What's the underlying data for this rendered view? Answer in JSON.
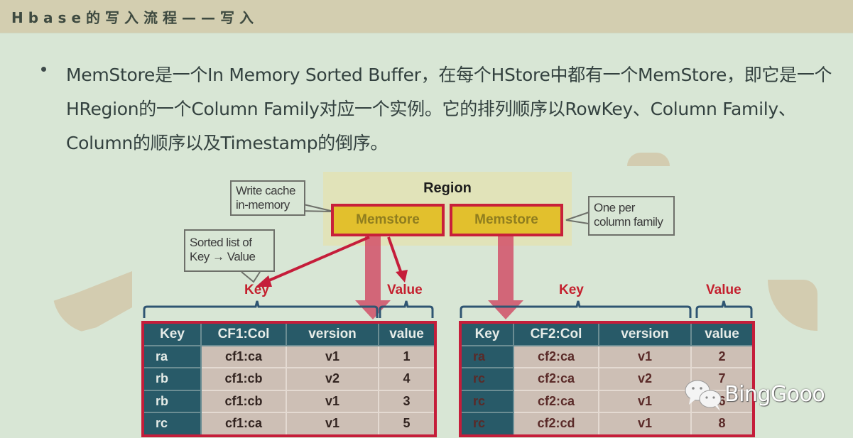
{
  "title": "Hbase的写入流程——写入",
  "bullet": {
    "text": "MemStore是一个In Memory Sorted Buffer，在每个HStore中都有一个MemStore，即它是一个HRegion的一个Column Family对应一个实例。它的排列顺序以RowKey、Column Family、Column的顺序以及Timestamp的倒序。"
  },
  "diagram": {
    "region_label": "Region",
    "memstores": [
      "Memstore",
      "Memstore"
    ],
    "callouts": {
      "write_cache": "Write cache\nin-memory",
      "sorted_list": "Sorted list of\nKey → Value",
      "one_per_cf": "One per\ncolumn family"
    },
    "left_labels": {
      "key": "Key",
      "value": "Value"
    },
    "right_labels": {
      "key": "Key",
      "value": "Value"
    },
    "colors": {
      "accent_red": "#c51d3a",
      "memstore_fill": "#e2c02d",
      "table_header": "#285a68",
      "table_cell": "#cdbfb5",
      "region_fill": "#e1e3b9"
    },
    "table1": {
      "headers": [
        "Key",
        "CF1:Col",
        "version",
        "value"
      ],
      "rows": [
        [
          "ra",
          "cf1:ca",
          "v1",
          "1"
        ],
        [
          "rb",
          "cf1:cb",
          "v2",
          "4"
        ],
        [
          "rb",
          "cf1:cb",
          "v1",
          "3"
        ],
        [
          "rc",
          "cf1:ca",
          "v1",
          "5"
        ]
      ]
    },
    "table2": {
      "headers": [
        "Key",
        "CF2:Col",
        "version",
        "value"
      ],
      "rows": [
        [
          "ra",
          "cf2:ca",
          "v1",
          "2"
        ],
        [
          "rc",
          "cf2:ca",
          "v2",
          "7"
        ],
        [
          "rc",
          "cf2:ca",
          "v1",
          "6"
        ],
        [
          "rc",
          "cf2:cd",
          "v1",
          "8"
        ]
      ]
    }
  },
  "watermark": {
    "icon": "wechat-icon",
    "text": "BingGooo"
  }
}
